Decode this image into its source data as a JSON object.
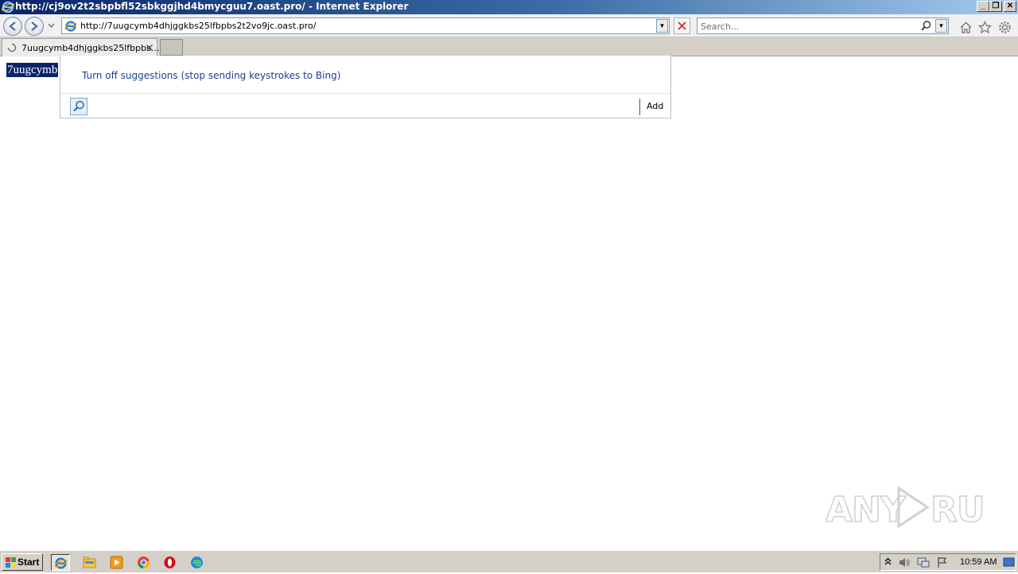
{
  "window": {
    "title": "http://cj9ov2t2sbpbfl52sbkggjhd4bmycguu7.oast.pro/ - Internet Explorer"
  },
  "navbar": {
    "address_value": "http://7uugcymb4dhjggkbs25lfbpbs2t2vo9jc.oast.pro/",
    "search_placeholder": "Search..."
  },
  "tabs": [
    {
      "label": "7uugcymb4dhjggkbs25lfbpbs..."
    }
  ],
  "page": {
    "highlighted_text": "7uugcymb"
  },
  "suggestions": {
    "turn_off_label": "Turn off suggestions (stop sending keystrokes to Bing)",
    "add_label": "Add"
  },
  "watermark": {
    "text": "ANY RUN"
  },
  "taskbar": {
    "start_label": "Start",
    "clock": "10:59 AM",
    "icons": [
      "internet-explorer-icon",
      "file-explorer-icon",
      "media-player-icon",
      "chrome-icon",
      "opera-icon",
      "edge-icon"
    ]
  },
  "colors": {
    "titlebar_start": "#0a246a",
    "selection": "#0a246a",
    "link_text": "#1c3f94",
    "chrome": "#d4d0c8"
  }
}
